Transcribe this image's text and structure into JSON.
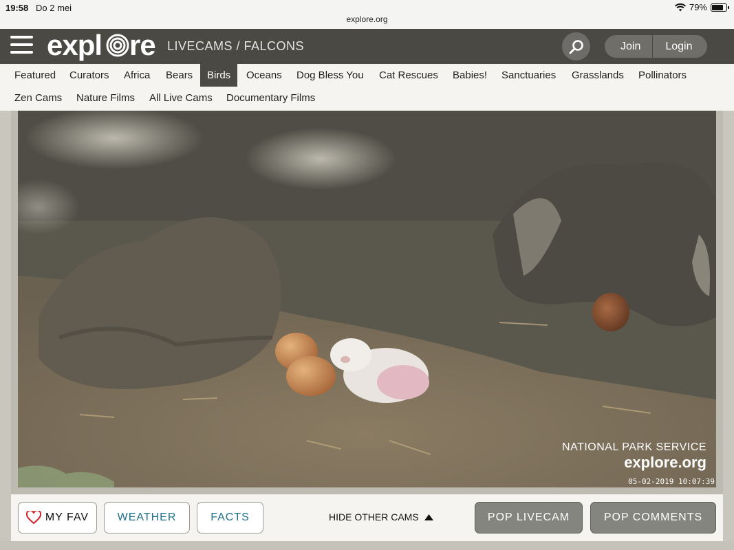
{
  "status": {
    "time": "19:58",
    "date": "Do 2 mei",
    "url": "explore.org",
    "battery_percent": "79%",
    "battery_level": 0.79
  },
  "header": {
    "logo": "explore",
    "breadcrumb": "LIVECAMS / FALCONS",
    "join_label": "Join",
    "login_label": "Login"
  },
  "nav": {
    "items": [
      "Featured",
      "Curators",
      "Africa",
      "Bears",
      "Birds",
      "Oceans",
      "Dog Bless You",
      "Cat Rescues",
      "Babies!",
      "Sanctuaries",
      "Grasslands",
      "Pollinators",
      "Zen Cams",
      "Nature Films",
      "All Live Cams",
      "Documentary Films"
    ],
    "active": "Birds"
  },
  "video": {
    "watermark_line1": "NATIONAL PARK SERVICE",
    "watermark_line2": "explore.org",
    "timestamp": "05-02-2019 10:07:39"
  },
  "controls": {
    "fav_label": "MY FAV",
    "weather_label": "WEATHER",
    "facts_label": "FACTS",
    "hide_cams_label": "HIDE OTHER CAMS",
    "pop_livecam_label": "POP LIVECAM",
    "pop_comments_label": "POP COMMENTS"
  },
  "colors": {
    "header_bg": "#4a4944",
    "accent_text": "#1d6f8c",
    "heart": "#d0222b"
  }
}
